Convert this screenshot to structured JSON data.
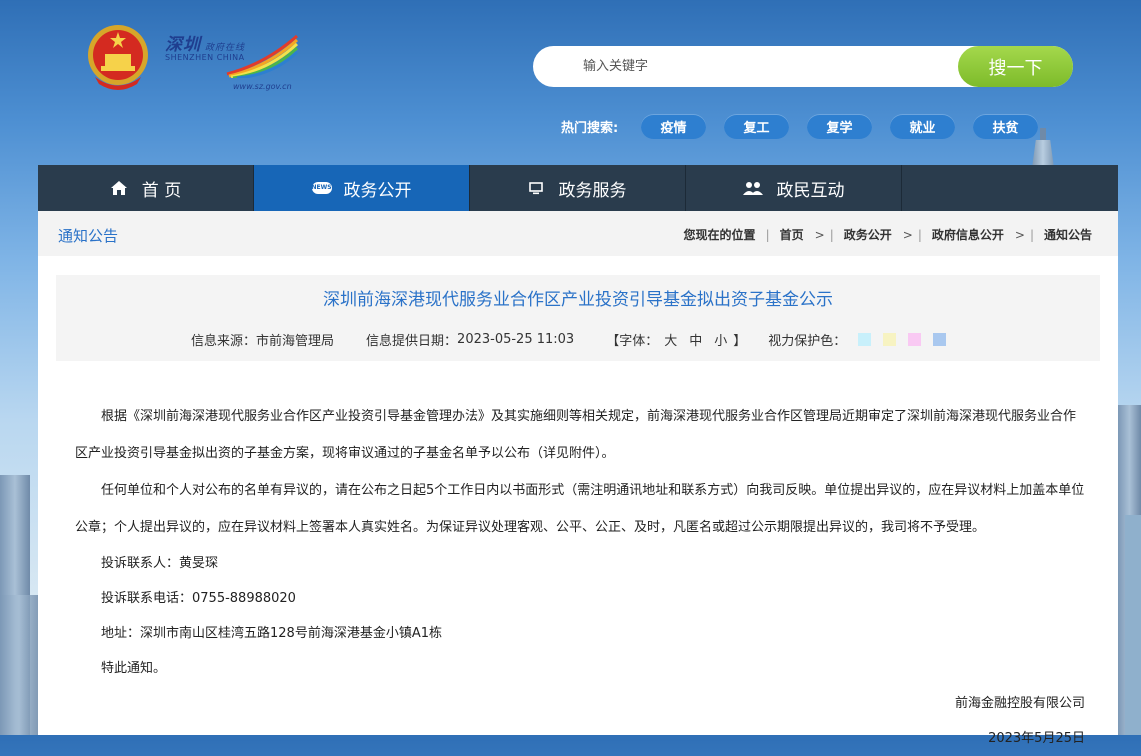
{
  "logo": {
    "cn": "深圳",
    "cn_small": "政府在线",
    "en": "SHENZHEN CHINA",
    "url": "www.sz.gov.cn"
  },
  "search": {
    "placeholder": "输入关键字",
    "button": "搜一下"
  },
  "hot": {
    "label": "热门搜索:",
    "tags": [
      "疫情",
      "复工",
      "复学",
      "就业",
      "扶贫"
    ]
  },
  "nav": {
    "items": [
      {
        "label": "首 页",
        "icon": "home-icon"
      },
      {
        "label": "政务公开",
        "icon": "news-icon"
      },
      {
        "label": "政务服务",
        "icon": "monitor-icon"
      },
      {
        "label": "政民互动",
        "icon": "people-icon"
      }
    ]
  },
  "crumb": {
    "section": "通知公告",
    "here": "您现在的位置",
    "path": [
      "首页",
      "政务公开",
      "政府信息公开",
      "通知公告"
    ]
  },
  "article": {
    "title": "深圳前海深港现代服务业合作区产业投资引导基金拟出资子基金公示",
    "source_label": "信息来源：",
    "source": "市前海管理局",
    "date_label": "信息提供日期：",
    "date": "2023-05-25 11:03",
    "font_open": "【字体：",
    "font_large": "大",
    "font_medium": "中",
    "font_small": "小",
    "font_close": "】",
    "eye_label": "视力保护色：",
    "eye_colors": [
      "#c8f0fb",
      "#f7f3c2",
      "#f9c9f3",
      "#a9c8ef"
    ],
    "p1": "根据《深圳前海深港现代服务业合作区产业投资引导基金管理办法》及其实施细则等相关规定，前海深港现代服务业合作区管理局近期审定了深圳前海深港现代服务业合作区产业投资引导基金拟出资的子基金方案，现将审议通过的子基金名单予以公布（详见附件）。",
    "p2": "任何单位和个人对公布的名单有异议的，请在公布之日起5个工作日内以书面形式（需注明通讯地址和联系方式）向我司反映。单位提出异议的，应在异议材料上加盖本单位公章；个人提出异议的，应在异议材料上签署本人真实姓名。为保证异议处理客观、公平、公正、及时，凡匿名或超过公示期限提出异议的，我司将不予受理。",
    "contact": "投诉联系人：黄旻琛",
    "phone": "投诉联系电话：0755-88988020",
    "address": "地址：深圳市南山区桂湾五路128号前海深港基金小镇A1栋",
    "notice": "特此通知。",
    "org": "前海金融控股有限公司",
    "sign_date": "2023年5月25日"
  }
}
